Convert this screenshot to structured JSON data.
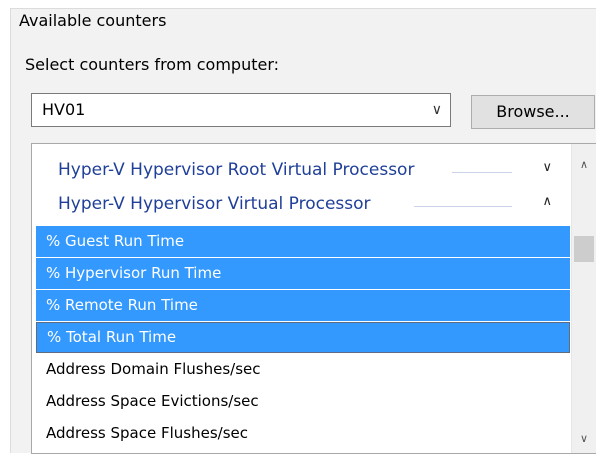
{
  "group": {
    "title": "Available counters"
  },
  "computer": {
    "label": "Select counters from computer:",
    "selected": "HV01",
    "browse_label": "Browse..."
  },
  "objects": [
    {
      "label": "Hyper-V Hypervisor Root Virtual Processor",
      "state": "collapsed"
    },
    {
      "label": "Hyper-V Hypervisor Virtual Processor",
      "state": "expanded"
    }
  ],
  "counters": [
    {
      "label": "% Guest Run Time",
      "selected": true
    },
    {
      "label": "% Hypervisor Run Time",
      "selected": true
    },
    {
      "label": "% Remote Run Time",
      "selected": true
    },
    {
      "label": "% Total Run Time",
      "selected": true,
      "focused": true
    },
    {
      "label": "Address Domain Flushes/sec",
      "selected": false
    },
    {
      "label": "Address Space Evictions/sec",
      "selected": false
    },
    {
      "label": "Address Space Flushes/sec",
      "selected": false
    }
  ],
  "icons": {
    "combo_arrow": "chevron-down-icon",
    "collapse": "chevron-up-icon",
    "expand": "chevron-down-icon",
    "scroll_up": "scroll-up-arrow-icon",
    "scroll_down": "scroll-down-arrow-icon"
  },
  "colors": {
    "selection": "#3399ff",
    "object_text": "#1f3f99"
  }
}
